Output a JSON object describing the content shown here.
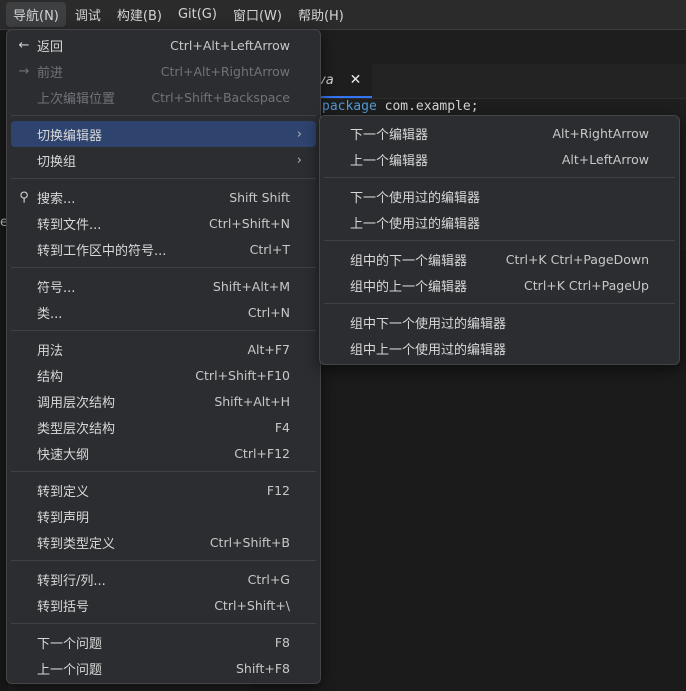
{
  "menubar": {
    "items": [
      "导航(N)",
      "调试",
      "构建(B)",
      "Git(G)",
      "窗口(W)",
      "帮助(H)"
    ]
  },
  "editor": {
    "tab_label": "va",
    "tab_close": "✕",
    "code_keyword": "package",
    "code_rest": " com.example;",
    "sidebar_fragment": "e"
  },
  "main_menu": {
    "groups": [
      [
        {
          "label": "返回",
          "shortcut": "Ctrl+Alt+LeftArrow",
          "icon": "←",
          "icon_name": "back-arrow-icon",
          "disabled": false
        },
        {
          "label": "前进",
          "shortcut": "Ctrl+Alt+RightArrow",
          "icon": "→",
          "icon_name": "forward-arrow-icon",
          "disabled": true
        },
        {
          "label": "上次编辑位置",
          "shortcut": "Ctrl+Shift+Backspace",
          "icon": "",
          "disabled": true
        }
      ],
      [
        {
          "label": "切换编辑器",
          "shortcut": "",
          "submenu": true,
          "highlight": true
        },
        {
          "label": "切换组",
          "shortcut": "",
          "submenu": true
        }
      ],
      [
        {
          "label": "搜索...",
          "shortcut": "Shift Shift",
          "icon": "⚲",
          "icon_name": "search-icon"
        },
        {
          "label": "转到文件...",
          "shortcut": "Ctrl+Shift+N"
        },
        {
          "label": "转到工作区中的符号...",
          "shortcut": "Ctrl+T"
        }
      ],
      [
        {
          "label": "符号...",
          "shortcut": "Shift+Alt+M"
        },
        {
          "label": "类...",
          "shortcut": "Ctrl+N"
        }
      ],
      [
        {
          "label": "用法",
          "shortcut": "Alt+F7"
        },
        {
          "label": "结构",
          "shortcut": "Ctrl+Shift+F10"
        },
        {
          "label": "调用层次结构",
          "shortcut": "Shift+Alt+H"
        },
        {
          "label": "类型层次结构",
          "shortcut": "F4"
        },
        {
          "label": "快速大纲",
          "shortcut": "Ctrl+F12"
        }
      ],
      [
        {
          "label": "转到定义",
          "shortcut": "F12"
        },
        {
          "label": "转到声明",
          "shortcut": ""
        },
        {
          "label": "转到类型定义",
          "shortcut": "Ctrl+Shift+B"
        }
      ],
      [
        {
          "label": "转到行/列...",
          "shortcut": "Ctrl+G"
        },
        {
          "label": "转到括号",
          "shortcut": "Ctrl+Shift+\\"
        }
      ],
      [
        {
          "label": "下一个问题",
          "shortcut": "F8"
        },
        {
          "label": "上一个问题",
          "shortcut": "Shift+F8"
        }
      ]
    ]
  },
  "sub_menu": {
    "groups": [
      [
        {
          "label": "下一个编辑器",
          "shortcut": "Alt+RightArrow"
        },
        {
          "label": "上一个编辑器",
          "shortcut": "Alt+LeftArrow"
        }
      ],
      [
        {
          "label": "下一个使用过的编辑器",
          "shortcut": ""
        },
        {
          "label": "上一个使用过的编辑器",
          "shortcut": ""
        }
      ],
      [
        {
          "label": "组中的下一个编辑器",
          "shortcut": "Ctrl+K Ctrl+PageDown"
        },
        {
          "label": "组中的上一个编辑器",
          "shortcut": "Ctrl+K Ctrl+PageUp"
        }
      ],
      [
        {
          "label": "组中下一个使用过的编辑器",
          "shortcut": ""
        },
        {
          "label": "组中上一个使用过的编辑器",
          "shortcut": ""
        }
      ]
    ],
    "arrow": "›"
  },
  "colors": {
    "highlight": "#2e436e",
    "accent": "#3574f0",
    "menu_bg": "#2b2d30"
  }
}
